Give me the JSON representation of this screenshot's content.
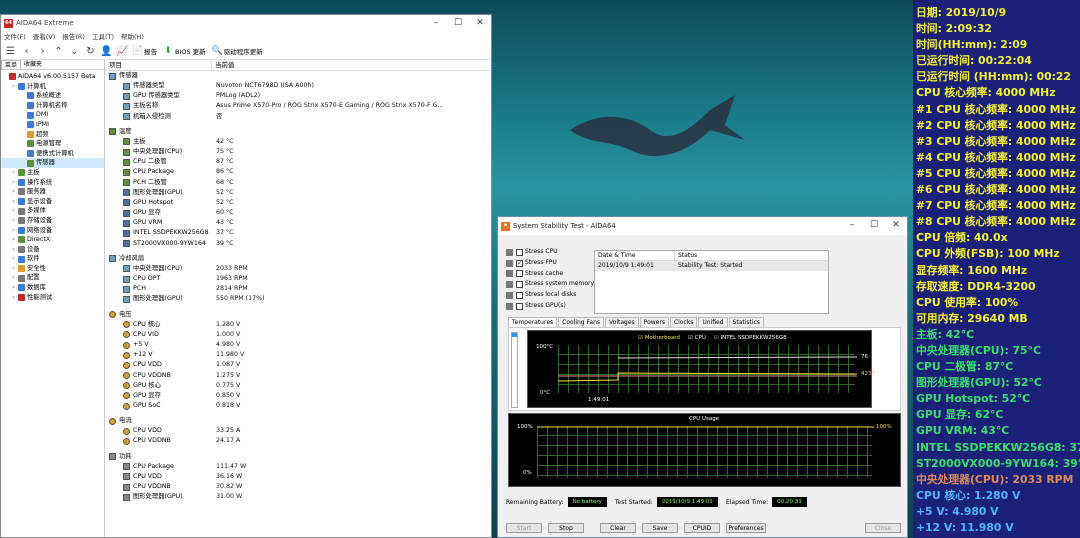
{
  "aida": {
    "title": "AIDA64 Extreme",
    "menu": [
      "文件(F)",
      "查看(V)",
      "报告(R)",
      "工具(T)",
      "帮助(H)"
    ],
    "toolbar": {
      "report": "报告",
      "bios": "BIOS 更新",
      "driver": "驱动程序更新"
    },
    "left_tabs": [
      "菜单",
      "收藏夹"
    ],
    "tree": [
      {
        "label": "AIDA64 v6.00.5157 Beta",
        "lvl": 0,
        "c": "#c62828"
      },
      {
        "label": "计算机",
        "lvl": 1,
        "c": "#3a7bd5"
      },
      {
        "label": "系统概述",
        "lvl": 2,
        "c": "#3a7bd5"
      },
      {
        "label": "计算机名称",
        "lvl": 2,
        "c": "#3a7bd5"
      },
      {
        "label": "DMI",
        "lvl": 2,
        "c": "#3a7bd5"
      },
      {
        "label": "IPMI",
        "lvl": 2,
        "c": "#3a7bd5"
      },
      {
        "label": "超频",
        "lvl": 2,
        "c": "#e39a2a"
      },
      {
        "label": "电源管理",
        "lvl": 2,
        "c": "#5a8f3c"
      },
      {
        "label": "便携式计算机",
        "lvl": 2,
        "c": "#3a7bd5"
      },
      {
        "label": "传感器",
        "lvl": 2,
        "c": "#5a8f3c",
        "sel": true
      },
      {
        "label": "主板",
        "lvl": 1,
        "c": "#5a8f3c"
      },
      {
        "label": "操作系统",
        "lvl": 1,
        "c": "#3a7bd5"
      },
      {
        "label": "服务器",
        "lvl": 1,
        "c": "#777"
      },
      {
        "label": "显示设备",
        "lvl": 1,
        "c": "#3a7bd5"
      },
      {
        "label": "多媒体",
        "lvl": 1,
        "c": "#777"
      },
      {
        "label": "存储设备",
        "lvl": 1,
        "c": "#777"
      },
      {
        "label": "网络设备",
        "lvl": 1,
        "c": "#3a7bd5"
      },
      {
        "label": "DirectX",
        "lvl": 1,
        "c": "#5a8f3c"
      },
      {
        "label": "设备",
        "lvl": 1,
        "c": "#777"
      },
      {
        "label": "软件",
        "lvl": 1,
        "c": "#3a7bd5"
      },
      {
        "label": "安全性",
        "lvl": 1,
        "c": "#e39a2a"
      },
      {
        "label": "配置",
        "lvl": 1,
        "c": "#777"
      },
      {
        "label": "数据库",
        "lvl": 1,
        "c": "#3a7bd5"
      },
      {
        "label": "性能测试",
        "lvl": 1,
        "c": "#c62828"
      }
    ],
    "cols": [
      "项目",
      "当前值"
    ],
    "sections": [
      {
        "title": "传感器",
        "rows": [
          [
            "传感器类型",
            "Nuvoton NCT6798D  (ISA A00h)"
          ],
          [
            "GPU 传感器类型",
            "PMLog  (ADL2)"
          ],
          [
            "主板名称",
            "Asus Prime X570-Pro / ROG Strix X570-E Gaming / ROG Strix X570-F G..."
          ],
          [
            "机箱入侵检测",
            "否"
          ]
        ]
      },
      {
        "title": "温度",
        "rows": [
          [
            "主板",
            "42 °C"
          ],
          [
            "中央处理器(CPU)",
            "75 °C"
          ],
          [
            "CPU 二极管",
            "87 °C"
          ],
          [
            "CPU Package",
            "86 °C"
          ],
          [
            "PCH 二极管",
            "68 °C"
          ],
          [
            "图形处理器(GPU)",
            "52 °C"
          ],
          [
            "GPU Hotspot",
            "52 °C"
          ],
          [
            "GPU 显存",
            "60 °C"
          ],
          [
            "GPU VRM",
            "43 °C"
          ],
          [
            "INTEL SSDPEKKW256G8",
            "37 °C"
          ],
          [
            "ST2000VX000-9YW164",
            "39 °C"
          ]
        ]
      },
      {
        "title": "冷却风扇",
        "rows": [
          [
            "中央处理器(CPU)",
            "2033 RPM"
          ],
          [
            "CPU OPT",
            "1963 RPM"
          ],
          [
            "PCH",
            "2814 RPM"
          ],
          [
            "图形处理器(GPU)",
            "550 RPM  (17%)"
          ]
        ]
      },
      {
        "title": "电压",
        "rows": [
          [
            "CPU 核心",
            "1.280 V"
          ],
          [
            "CPU VID",
            "1.000 V"
          ],
          [
            "+5 V",
            "4.980 V"
          ],
          [
            "+12 V",
            "11.980 V"
          ],
          [
            "CPU VDD",
            "1.087 V"
          ],
          [
            "CPU VDDNB",
            "1.275 V"
          ],
          [
            "GPU 核心",
            "0.775 V"
          ],
          [
            "GPU 显存",
            "0.850 V"
          ],
          [
            "GPU SoC",
            "0.818 V"
          ]
        ]
      },
      {
        "title": "电流",
        "rows": [
          [
            "CPU VDD",
            "33.25 A"
          ],
          [
            "CPU VDDNB",
            "24.17 A"
          ]
        ]
      },
      {
        "title": "功耗",
        "rows": [
          [
            "CPU Package",
            "111.47 W"
          ],
          [
            "CPU VDD",
            "36.16 W"
          ],
          [
            "CPU VDDNB",
            "30.82 W"
          ],
          [
            "图形处理器(GPU)",
            "31.00 W"
          ]
        ]
      }
    ]
  },
  "sst": {
    "title": "System Stability Test - AIDA64",
    "checks": [
      [
        "Stress CPU",
        false
      ],
      [
        "Stress FPU",
        true
      ],
      [
        "Stress cache",
        false
      ],
      [
        "Stress system memory",
        false
      ],
      [
        "Stress local disks",
        false
      ],
      [
        "Stress GPU(s)",
        false
      ]
    ],
    "table_head": [
      "Date & Time",
      "Status"
    ],
    "table_row": [
      "2019/10/9 1:49:01",
      "Stability Test: Started"
    ],
    "tabs": [
      "Temperatures",
      "Cooling Fans",
      "Voltages",
      "Powers",
      "Clocks",
      "Unified",
      "Statistics"
    ],
    "legend": [
      "Motherboard",
      "CPU",
      "INTEL SSDPEKKW256G8"
    ],
    "temp_top": "100°C",
    "temp_bot": "0°C",
    "temp_time": "1:49:01",
    "temp_vals": [
      "76",
      "42",
      "37"
    ],
    "cpu_title": "CPU Usage",
    "cpu_top": "100%",
    "cpu_bot": "0%",
    "cpu_val": "100%",
    "battery_lbl": "Remaining Battery:",
    "battery": "No battery",
    "started_lbl": "Test Started:",
    "started": "2019/10/9 1:49:01",
    "elapsed_lbl": "Elapsed Time:",
    "elapsed": "00:20:31",
    "buttons": [
      "Start",
      "Stop",
      "Clear",
      "Save",
      "CPUID",
      "Preferences",
      "Close"
    ]
  },
  "osd": [
    {
      "t": "日期: 2019/10/9",
      "c": "oy"
    },
    {
      "t": "时间: 2:09:32",
      "c": "oy"
    },
    {
      "t": "时间(HH:mm): 2:09",
      "c": "oy"
    },
    {
      "t": "已运行时间: 00:22:04",
      "c": "oy"
    },
    {
      "t": "已运行时间 (HH:mm): 00:22",
      "c": "oy"
    },
    {
      "t": "CPU 核心频率: 4000 MHz",
      "c": "oy"
    },
    {
      "t": "#1 CPU 核心频率: 4000 MHz",
      "c": "oy"
    },
    {
      "t": "#2 CPU 核心频率: 4000 MHz",
      "c": "oy"
    },
    {
      "t": "#3 CPU 核心频率: 4000 MHz",
      "c": "oy"
    },
    {
      "t": "#4 CPU 核心频率: 4000 MHz",
      "c": "oy"
    },
    {
      "t": "#5 CPU 核心频率: 4000 MHz",
      "c": "oy"
    },
    {
      "t": "#6 CPU 核心频率: 4000 MHz",
      "c": "oy"
    },
    {
      "t": "#7 CPU 核心频率: 4000 MHz",
      "c": "oy"
    },
    {
      "t": "#8 CPU 核心频率: 4000 MHz",
      "c": "oy"
    },
    {
      "t": "CPU 倍频: 40.0x",
      "c": "oy"
    },
    {
      "t": "CPU 外频(FSB): 100 MHz",
      "c": "oy"
    },
    {
      "t": "显存频率: 1600 MHz",
      "c": "oy"
    },
    {
      "t": "存取速度: DDR4-3200",
      "c": "oy"
    },
    {
      "t": "CPU 使用率: 100%",
      "c": "oy"
    },
    {
      "t": "可用内存: 29640 MB",
      "c": "oy"
    },
    {
      "t": "主板: 42°C",
      "c": "og"
    },
    {
      "t": "中央处理器(CPU): 75°C",
      "c": "og"
    },
    {
      "t": "CPU 二极管: 87°C",
      "c": "og"
    },
    {
      "t": "图形处理器(GPU): 52°C",
      "c": "og"
    },
    {
      "t": "GPU Hotspot: 52°C",
      "c": "og"
    },
    {
      "t": "GPU 显存: 62°C",
      "c": "og"
    },
    {
      "t": "GPU VRM: 43°C",
      "c": "og"
    },
    {
      "t": "INTEL SSDPEKKW256G8: 37°C",
      "c": "og"
    },
    {
      "t": "ST2000VX000-9YW164: 39°C",
      "c": "og"
    },
    {
      "t": "中央处理器(CPU): 2033 RPM",
      "c": "oo"
    },
    {
      "t": "CPU 核心: 1.280 V",
      "c": "oc"
    },
    {
      "t": "+5 V: 4.980 V",
      "c": "oc"
    },
    {
      "t": "+12 V: 11.980 V",
      "c": "oc"
    }
  ]
}
